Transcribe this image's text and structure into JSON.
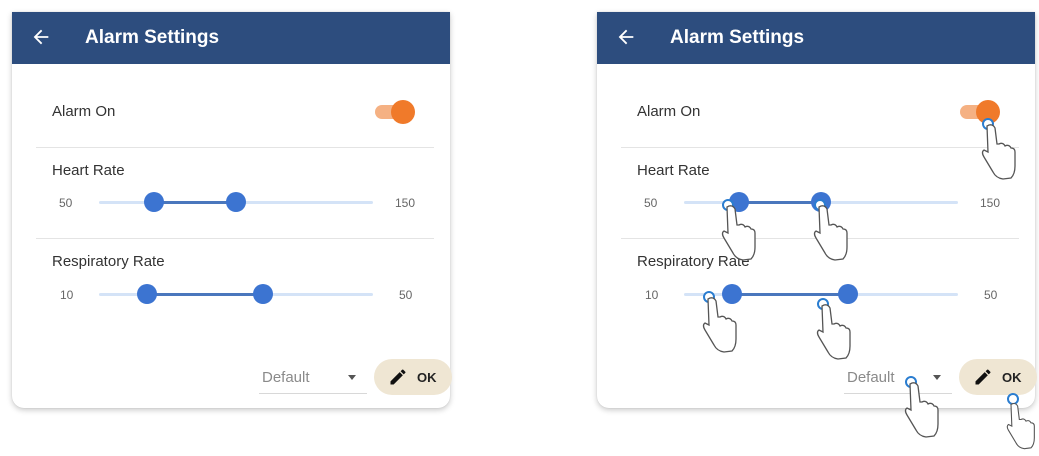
{
  "panels": [
    {
      "header": {
        "title": "Alarm Settings",
        "back_icon": "arrow-left-icon"
      },
      "alarm": {
        "label": "Alarm On",
        "enabled": true
      },
      "heart_rate": {
        "label": "Heart Rate",
        "min": "50",
        "max": "150",
        "low_value": 70,
        "high_value": 100
      },
      "respiratory_rate": {
        "label": "Respiratory Rate",
        "min": "10",
        "max": "50",
        "low_value": 17,
        "high_value": 34
      },
      "preset": {
        "value": "Default"
      },
      "ok_button": {
        "label": "OK",
        "icon": "pencil-icon"
      }
    },
    {
      "header": {
        "title": "Alarm Settings",
        "back_icon": "arrow-left-icon"
      },
      "alarm": {
        "label": "Alarm On",
        "enabled": true
      },
      "heart_rate": {
        "label": "Heart Rate",
        "min": "50",
        "max": "150",
        "low_value": 70,
        "high_value": 100
      },
      "respiratory_rate": {
        "label": "Respiratory Rate",
        "min": "10",
        "max": "50",
        "low_value": 17,
        "high_value": 34
      },
      "preset": {
        "value": "Default"
      },
      "ok_button": {
        "label": "OK",
        "icon": "pencil-icon"
      }
    }
  ],
  "colors": {
    "header": "#2d4d7e",
    "toggle_on": "#f07a2a",
    "slider_thumb": "#3c74d1",
    "ok_button_bg": "#efe6d3"
  },
  "annotations": {
    "gesture_icon": "hand-pointer-icon"
  }
}
